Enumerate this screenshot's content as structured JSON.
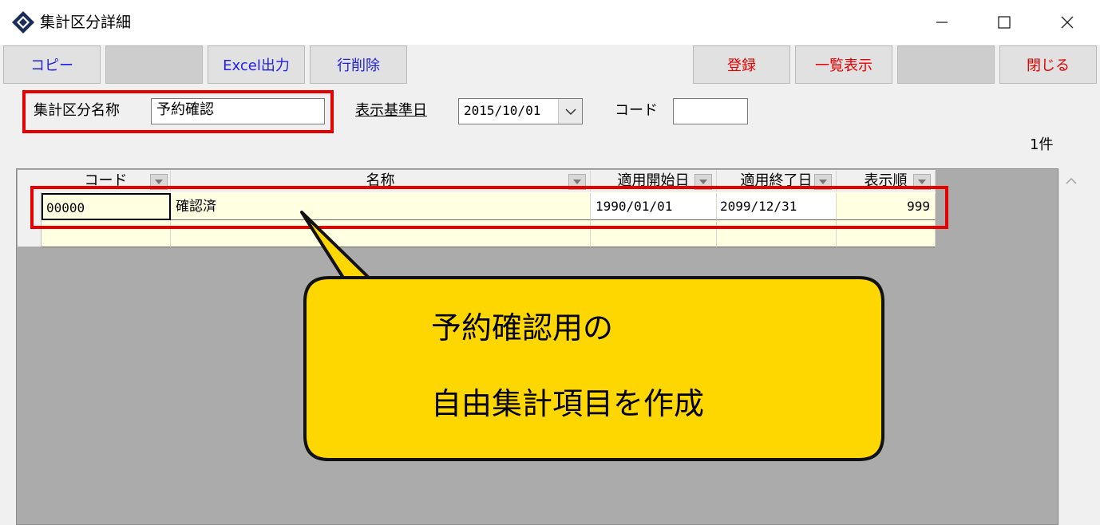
{
  "window": {
    "title": "集計区分詳細",
    "controls": {
      "minimize": "—",
      "maximize": "☐",
      "close": "✕"
    }
  },
  "toolbar": {
    "copy": "コピー",
    "excel": "Excel出力",
    "delete_row": "行削除",
    "register": "登録",
    "list_view": "一覧表示",
    "close": "閉じる"
  },
  "filter": {
    "name_label": "集計区分名称",
    "name_value": "予約確認",
    "date_label": "表示基準日",
    "date_value": "2015/10/01",
    "code_label": "コード",
    "code_value": ""
  },
  "record_count": "1件",
  "grid": {
    "columns": [
      "コード",
      "名称",
      "適用開始日",
      "適用終了日",
      "表示順"
    ],
    "rows": [
      {
        "code": "00000",
        "name": "確認済",
        "start": "1990/01/01",
        "end": "2099/12/31",
        "order": "999"
      }
    ]
  },
  "callout": {
    "line1": "予約確認用の",
    "line2": "自由集計項目を作成"
  },
  "colors": {
    "highlight": "#e60000",
    "callout_fill": "#ffd700",
    "label_blue": "#1f1fe6",
    "label_red": "#e60000",
    "row_fill": "#ffffe1"
  }
}
